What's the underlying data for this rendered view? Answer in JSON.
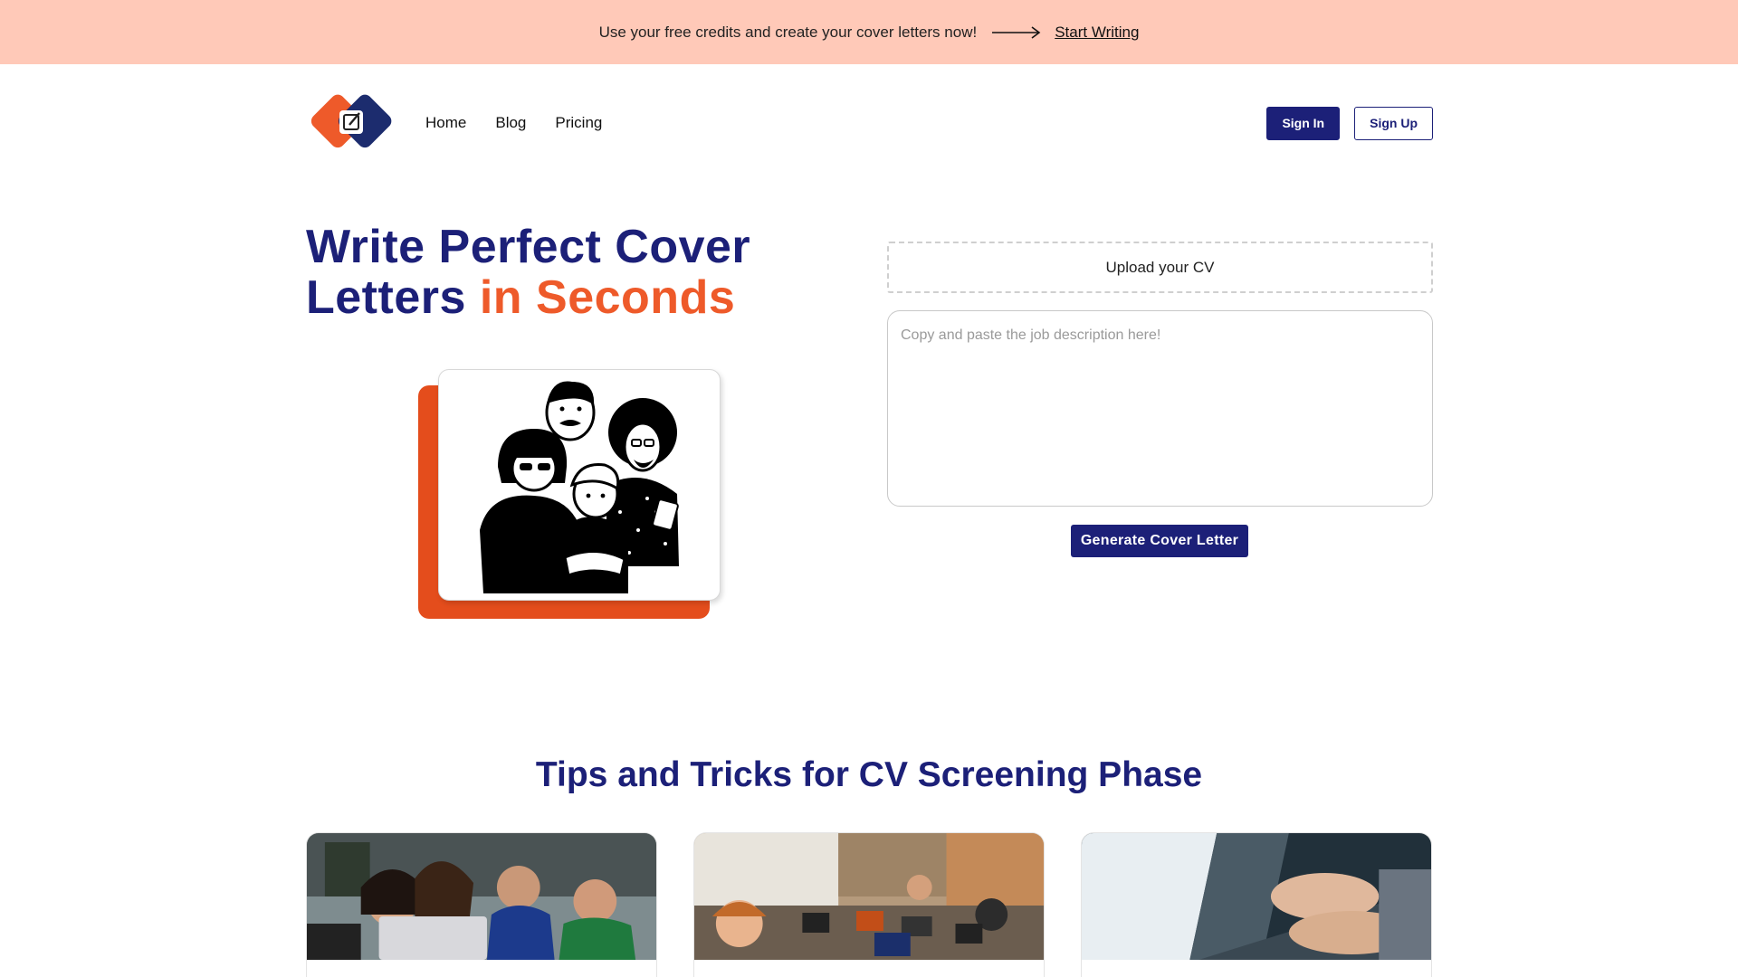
{
  "banner": {
    "message": "Use your free credits and create your cover letters now!",
    "cta": "Start Writing"
  },
  "nav": {
    "links": [
      "Home",
      "Blog",
      "Pricing"
    ],
    "sign_in": "Sign In",
    "sign_up": "Sign Up"
  },
  "hero": {
    "title_line1": "Write Perfect Cover",
    "title_line2a": "Letters",
    "title_line2b": "in Seconds"
  },
  "form": {
    "upload_label": "Upload your CV",
    "job_placeholder": "Copy and paste the job description here!",
    "job_value": "",
    "generate_label": "Generate Cover Letter"
  },
  "tips": {
    "title": "Tips and Tricks for CV Screening Phase",
    "cards": [
      {
        "image": "team-laptop-photo"
      },
      {
        "image": "meeting-room-photo"
      },
      {
        "image": "typing-laptop-photo"
      }
    ]
  },
  "colors": {
    "brand_navy": "#1c2078",
    "brand_orange": "#ee5a2a",
    "banner_bg": "#ffc9b8"
  }
}
